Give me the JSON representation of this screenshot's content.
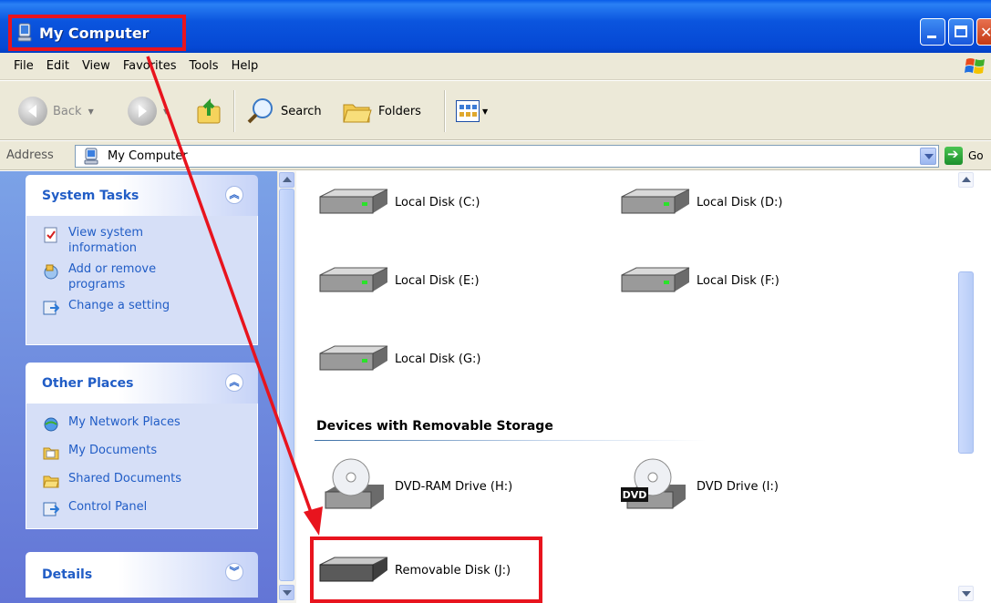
{
  "window": {
    "title": "My Computer",
    "accent_color": "#0a4fd6",
    "annotation_color": "#e8141e"
  },
  "menu": [
    "File",
    "Edit",
    "View",
    "Favorites",
    "Tools",
    "Help"
  ],
  "toolbar": {
    "back_label": "Back",
    "search_label": "Search",
    "folders_label": "Folders"
  },
  "address": {
    "label": "Address",
    "value": "My Computer",
    "go_label": "Go"
  },
  "system_tasks": {
    "title": "System Tasks",
    "items": [
      {
        "label": "View system information",
        "icon": "system-info-icon"
      },
      {
        "label": "Add or remove programs",
        "icon": "add-remove-icon"
      },
      {
        "label": "Change a setting",
        "icon": "control-panel-icon"
      }
    ]
  },
  "other_places": {
    "title": "Other Places",
    "items": [
      {
        "label": "My Network Places",
        "icon": "network-places-icon"
      },
      {
        "label": "My Documents",
        "icon": "my-documents-icon"
      },
      {
        "label": "Shared Documents",
        "icon": "shared-folder-icon"
      },
      {
        "label": "Control Panel",
        "icon": "control-panel-icon"
      }
    ]
  },
  "details": {
    "title": "Details"
  },
  "drives": [
    {
      "label": "Local Disk (C:)",
      "icon": "hard-disk-icon"
    },
    {
      "label": "Local Disk (D:)",
      "icon": "hard-disk-icon"
    },
    {
      "label": "Local Disk (E:)",
      "icon": "hard-disk-icon"
    },
    {
      "label": "Local Disk (F:)",
      "icon": "hard-disk-icon"
    },
    {
      "label": "Local Disk (G:)",
      "icon": "hard-disk-icon"
    }
  ],
  "removable_section": {
    "title": "Devices with Removable Storage",
    "items": [
      {
        "label": "DVD-RAM Drive (H:)",
        "icon": "dvd-ram-drive-icon"
      },
      {
        "label": "DVD Drive (I:)",
        "icon": "dvd-drive-icon",
        "badge": "DVD"
      },
      {
        "label": "Removable Disk (J:)",
        "icon": "removable-disk-icon"
      }
    ]
  }
}
